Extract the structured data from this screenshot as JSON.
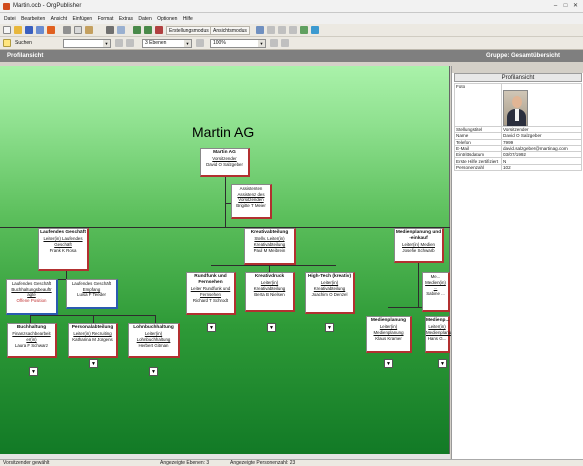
{
  "window": {
    "title": "Martin.ocb - OrgPublisher"
  },
  "menu": [
    "Datei",
    "Bearbeiten",
    "Ansicht",
    "Einfügen",
    "Format",
    "Extras",
    "Daten",
    "Optionen",
    "Hilfe"
  ],
  "toolbar": {
    "create_mode": "Erstellungsmodus",
    "view_mode": "Ansichtsmodus",
    "search": "Suchen",
    "levels": "3 Ebenen",
    "zoom": "100%"
  },
  "tabs": {
    "left": "Profilansicht",
    "right": "Gruppe: Gesamtübersicht"
  },
  "chart": {
    "title": "Martin AG",
    "ceo": {
      "name": "Martin AG",
      "role": "Vorsitzender",
      "person": "David O Salzgeber"
    },
    "assistant": {
      "name": "Assistenten",
      "role": "Assistenz des Vorsitzenden",
      "person": "Brigitte T Meier"
    },
    "laufendes": {
      "name": "Laufendes Geschäft",
      "role": "Leiter(in) Laufendes Geschäft",
      "person": "Frank K Rosa"
    },
    "kreativ": {
      "name": "Kreativabteilung",
      "role": "Stellv. Leiter(in) Kreativabteilung",
      "person": "Paul M Meibrein"
    },
    "medien": {
      "name": "Medienplanung und -einkauf",
      "role": "Leiter(in) Medien",
      "person": "Josefie Schwarb"
    },
    "lg1": {
      "name": "Laufendes Geschäft",
      "role": "Buchhaltungsbeauftr agte",
      "person": "Offene Position"
    },
    "lg2": {
      "name": "Laufendes Geschäft",
      "role": "Empfang",
      "person": "Luisa F Teeder"
    },
    "buch": {
      "name": "Buchhaltung",
      "role": "Finanzsachbearbeit er(in)",
      "person": "Laura F Schwarz"
    },
    "personal": {
      "name": "Personalabteilung",
      "role": "Leiter(in) Recruiting",
      "person": "Katharina M Jürgens"
    },
    "lohn": {
      "name": "Lohnbuchhaltung",
      "role": "Leiter(in) Lohnbuchhaltung",
      "person": "Herbert Gitman"
    },
    "rundfunk": {
      "name": "Rundfunk und Fernsehen",
      "role": "Leiter Rundfunk und Fernsehen",
      "person": "Richard T Schrodt"
    },
    "kreativdruck": {
      "name": "Kreativdruck",
      "role": "Leiter(in) Kreativabteilung",
      "person": "Berta B Nielsen"
    },
    "hightech": {
      "name": "High-Tech (kreativ)",
      "role": "Leiter(in) Kreativabteilung",
      "person": "Joachim O Denzel"
    },
    "medien2": {
      "name": "Medienplanung",
      "role": "Leiter(in) Medienplanung",
      "person": "Klaus Kramer"
    },
    "medien3": {
      "name": "Medienp...",
      "role": "Leiter(in) Medienplanung",
      "person": "Hans G..."
    },
    "medien4": {
      "name": "Me...",
      "role": "Medien(in) ...",
      "person": "Sabine ..."
    }
  },
  "profile": {
    "title": "Profilansicht",
    "rows": [
      {
        "label": "Foto",
        "value": ""
      },
      {
        "label": "Stellungstitel",
        "value": "Vorsitzender"
      },
      {
        "label": "Name",
        "value": "David O Salzgeber"
      },
      {
        "label": "Telefon",
        "value": "7999"
      },
      {
        "label": "E-Mail",
        "value": "david.salzgeber@martinag.com"
      },
      {
        "label": "Eintrittsdatum",
        "value": "03/07/1992"
      },
      {
        "label": "Erste Hilfe zertifiziert",
        "value": "N"
      },
      {
        "label": "Personenzahl",
        "value": "102"
      }
    ]
  },
  "status": {
    "left": "Vorsitzender gewählt",
    "levels": "Angezeigte Ebenen: 3",
    "people": "Angezeigte Personenzahl: 23"
  }
}
